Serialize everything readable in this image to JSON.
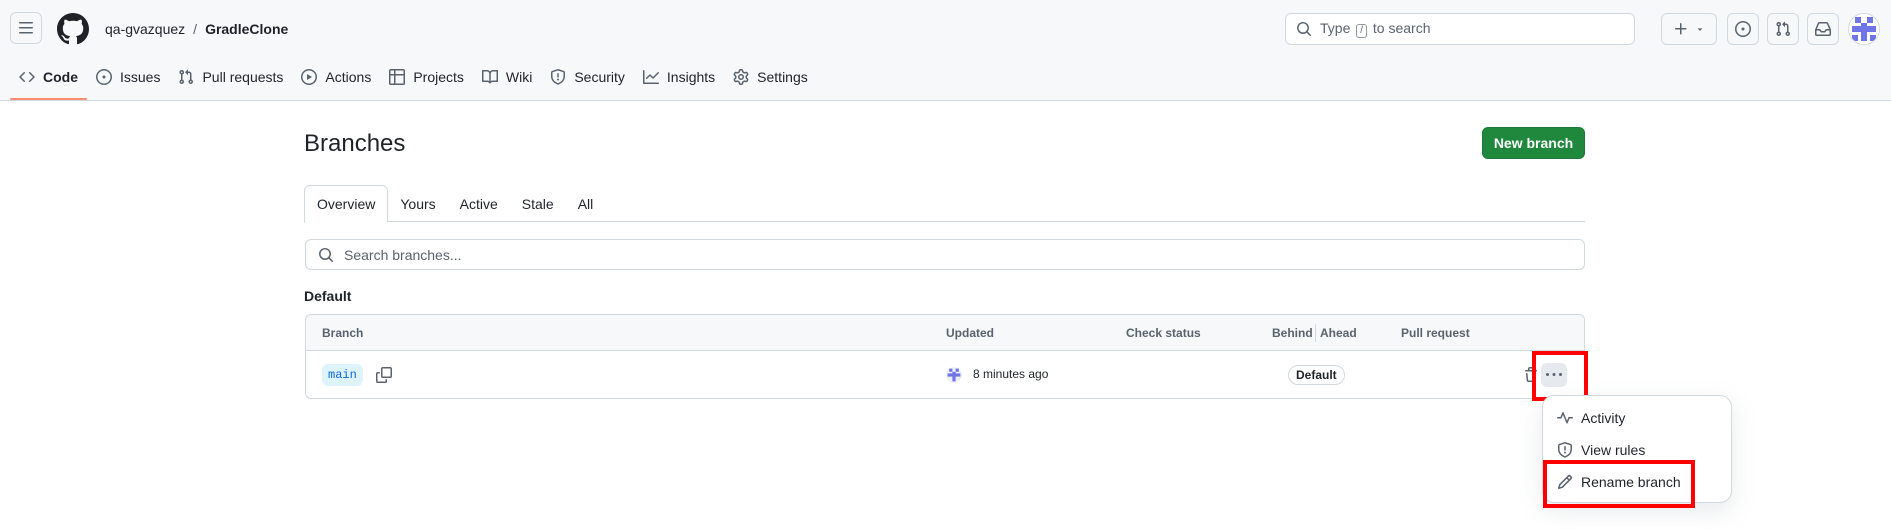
{
  "header": {
    "owner": "qa-gvazquez",
    "separator": "/",
    "repo": "GradleClone",
    "search_prefix": "Type",
    "search_key": "/",
    "search_suffix": "to search"
  },
  "nav": {
    "tabs": [
      {
        "label": "Code",
        "icon": "code-icon",
        "active": true
      },
      {
        "label": "Issues",
        "icon": "issue-opened-icon"
      },
      {
        "label": "Pull requests",
        "icon": "git-pull-request-icon"
      },
      {
        "label": "Actions",
        "icon": "play-icon"
      },
      {
        "label": "Projects",
        "icon": "table-icon"
      },
      {
        "label": "Wiki",
        "icon": "book-icon"
      },
      {
        "label": "Security",
        "icon": "shield-icon"
      },
      {
        "label": "Insights",
        "icon": "graph-icon"
      },
      {
        "label": "Settings",
        "icon": "gear-icon"
      }
    ]
  },
  "page": {
    "title": "Branches",
    "new_branch_label": "New branch",
    "tabs": [
      "Overview",
      "Yours",
      "Active",
      "Stale",
      "All"
    ],
    "active_tab": "Overview",
    "search_placeholder": "Search branches...",
    "section_label": "Default"
  },
  "table": {
    "columns": {
      "branch": "Branch",
      "updated": "Updated",
      "check_status": "Check status",
      "behind": "Behind",
      "ahead": "Ahead",
      "pull_request": "Pull request"
    },
    "rows": [
      {
        "name": "main",
        "updated": "8 minutes ago",
        "badge": "Default"
      }
    ]
  },
  "menu": {
    "items": [
      {
        "label": "Activity",
        "icon": "pulse-icon"
      },
      {
        "label": "View rules",
        "icon": "shield-icon"
      },
      {
        "label": "Rename branch",
        "icon": "pencil-icon"
      }
    ]
  },
  "colors": {
    "accent_green": "#1f883d",
    "highlight_red": "#ff0000",
    "active_tab_underline": "#fd8c73",
    "branch_chip_bg": "#ddf4ff",
    "branch_chip_text": "#0969da"
  }
}
